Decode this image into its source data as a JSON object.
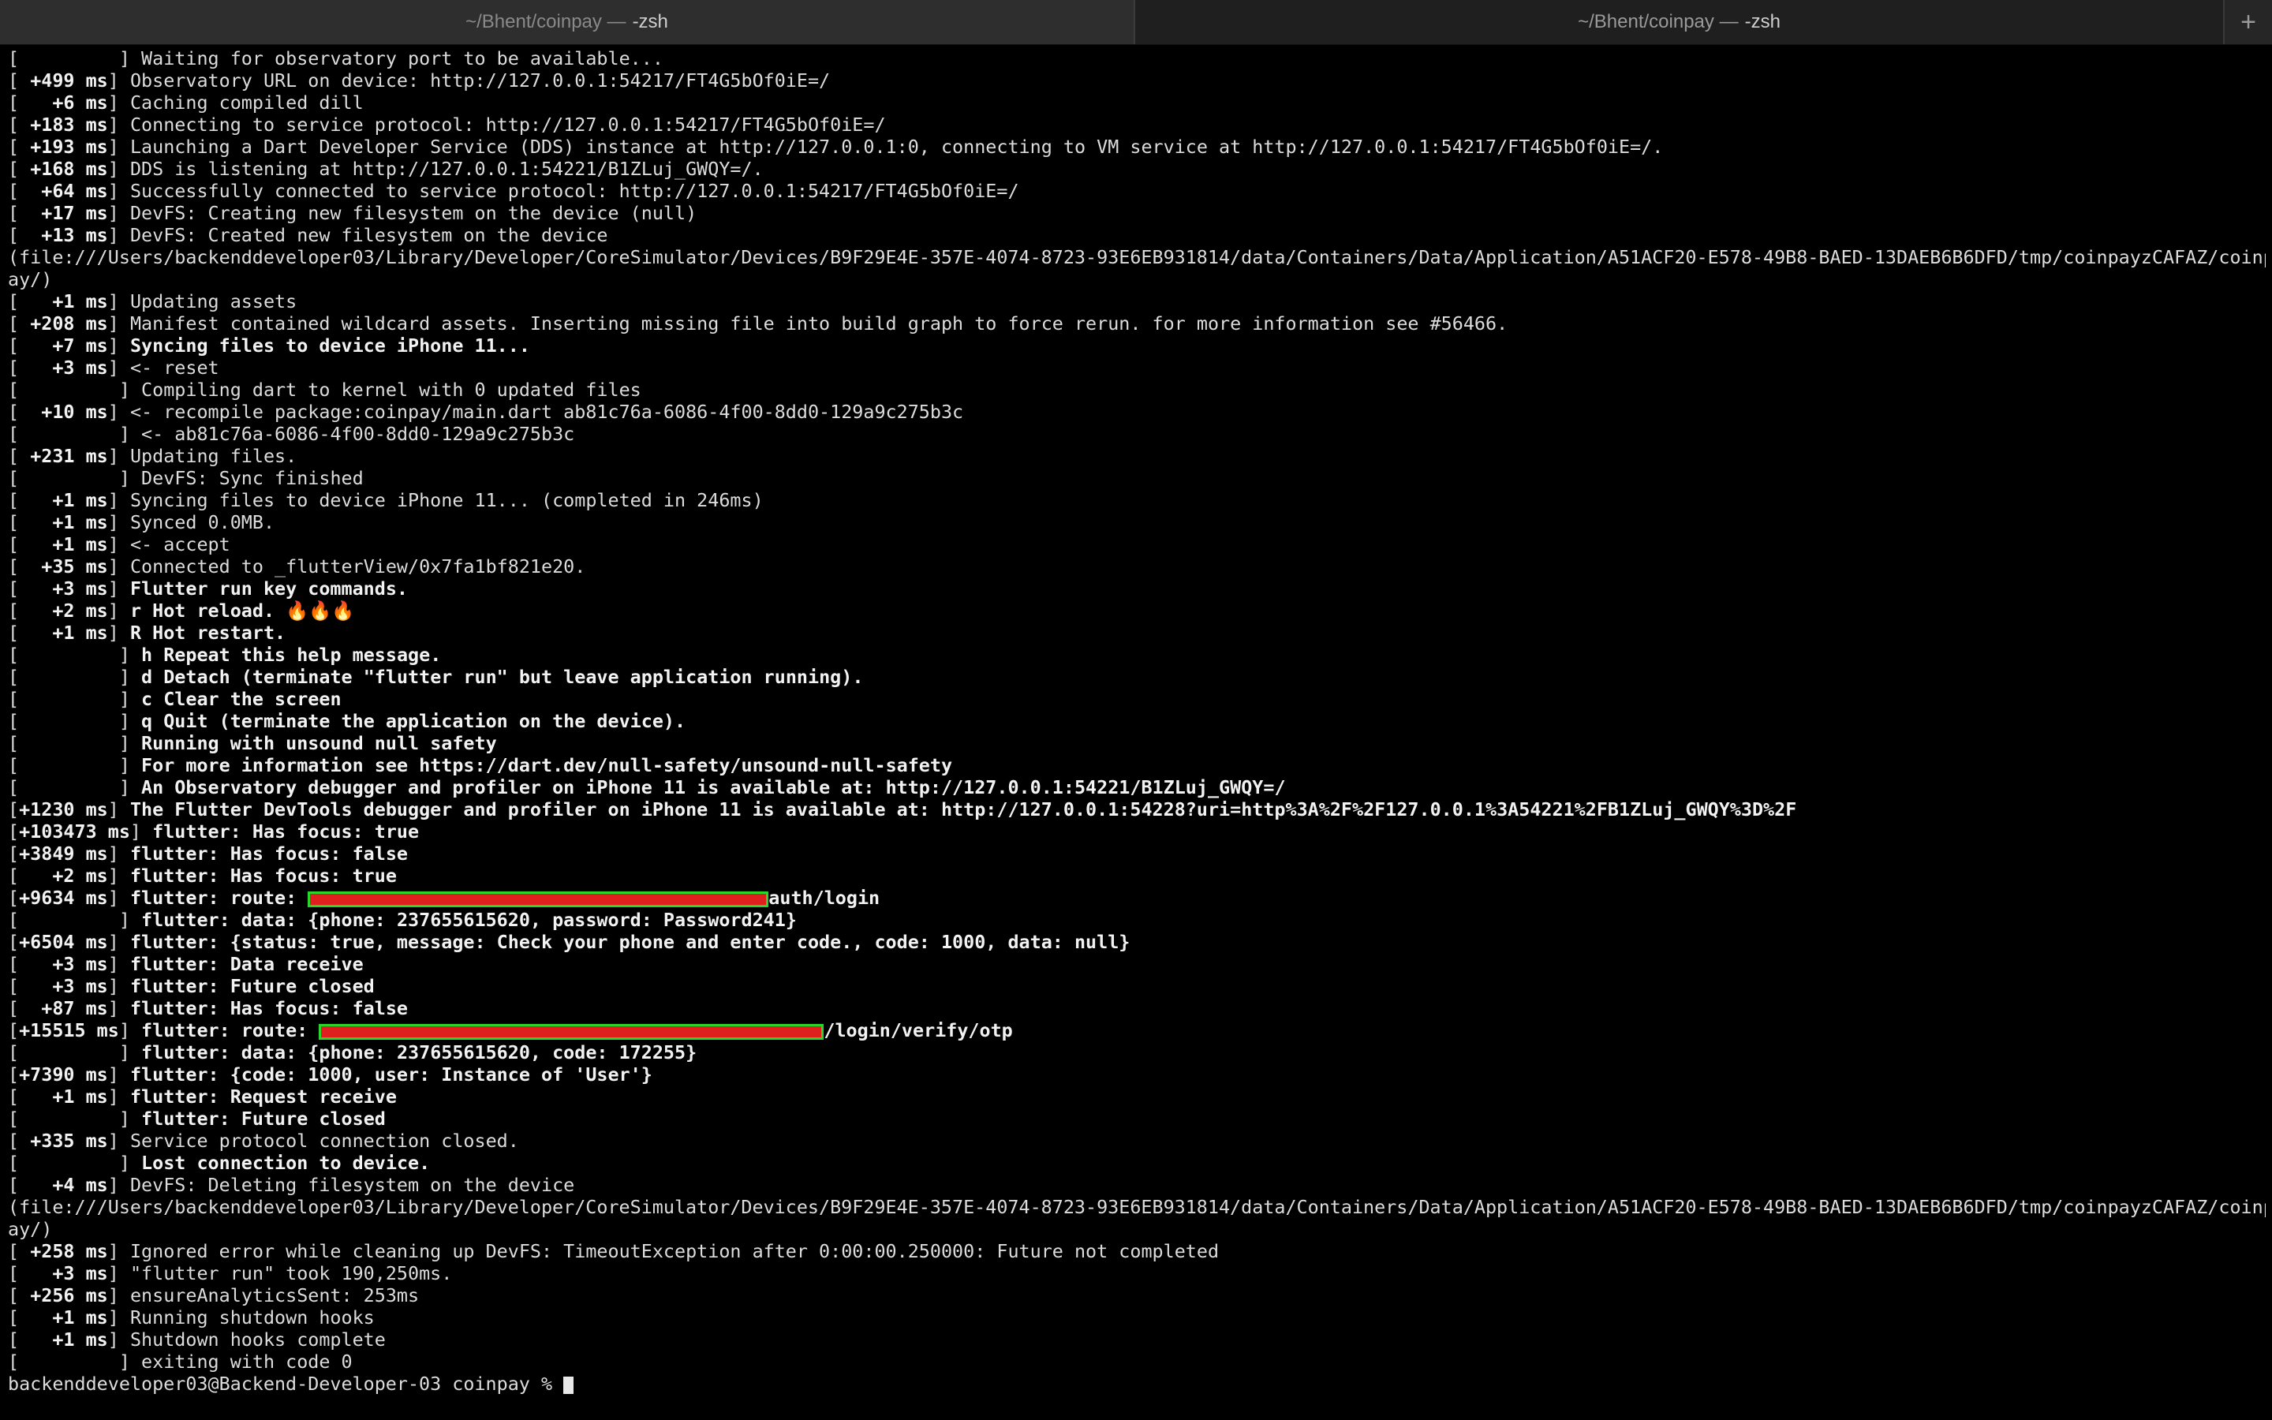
{
  "tabs": [
    {
      "path": "~/Bhent/coinpay —",
      "shell": "-zsh"
    },
    {
      "path": "~/Bhent/coinpay —",
      "shell": "-zsh"
    }
  ],
  "new_tab_label": "+",
  "lines": [
    {
      "ts": "        ",
      "text": "Waiting for observatory port to be available..."
    },
    {
      "ts": "+499 ms",
      "text": "Observatory URL on device: http://127.0.0.1:54217/FT4G5bOf0iE=/"
    },
    {
      "ts": "  +6 ms",
      "text": "Caching compiled dill"
    },
    {
      "ts": "+183 ms",
      "text": "Connecting to service protocol: http://127.0.0.1:54217/FT4G5bOf0iE=/"
    },
    {
      "ts": "+193 ms",
      "text": "Launching a Dart Developer Service (DDS) instance at http://127.0.0.1:0, connecting to VM service at http://127.0.0.1:54217/FT4G5bOf0iE=/."
    },
    {
      "ts": "+168 ms",
      "text": "DDS is listening at http://127.0.0.1:54221/B1ZLuj_GWQY=/."
    },
    {
      "ts": " +64 ms",
      "text": "Successfully connected to service protocol: http://127.0.0.1:54217/FT4G5bOf0iE=/"
    },
    {
      "ts": " +17 ms",
      "text": "DevFS: Creating new filesystem on the device (null)"
    },
    {
      "ts": " +13 ms",
      "text": "DevFS: Created new filesystem on the device"
    },
    {
      "raw": "(file:///Users/backenddeveloper03/Library/Developer/CoreSimulator/Devices/B9F29E4E-357E-4074-8723-93E6EB931814/data/Containers/Data/Application/A51ACF20-E578-49B8-BAED-13DAEB6B6DFD/tmp/coinpayzCAFAZ/coinp"
    },
    {
      "raw": "ay/)"
    },
    {
      "ts": "  +1 ms",
      "text": "Updating assets"
    },
    {
      "ts": "+208 ms",
      "text": "Manifest contained wildcard assets. Inserting missing file into build graph to force rerun. for more information see #56466."
    },
    {
      "ts": "  +7 ms",
      "text": "Syncing files to device iPhone 11...",
      "bold": true
    },
    {
      "ts": "  +3 ms",
      "text": "<- reset"
    },
    {
      "ts": "        ",
      "text": "Compiling dart to kernel with 0 updated files"
    },
    {
      "ts": " +10 ms",
      "text": "<- recompile package:coinpay/main.dart ab81c76a-6086-4f00-8dd0-129a9c275b3c"
    },
    {
      "ts": "        ",
      "text": "<- ab81c76a-6086-4f00-8dd0-129a9c275b3c"
    },
    {
      "ts": "+231 ms",
      "text": "Updating files."
    },
    {
      "ts": "        ",
      "text": "DevFS: Sync finished"
    },
    {
      "ts": "  +1 ms",
      "text": "Syncing files to device iPhone 11... (completed in 246ms)"
    },
    {
      "ts": "  +1 ms",
      "text": "Synced 0.0MB."
    },
    {
      "ts": "  +1 ms",
      "text": "<- accept"
    },
    {
      "ts": " +35 ms",
      "text": "Connected to _flutterView/0x7fa1bf821e20."
    },
    {
      "ts": "  +3 ms",
      "text": "Flutter run key commands.",
      "bold": true
    },
    {
      "ts": "  +2 ms",
      "text": "r Hot reload. ",
      "bold": true,
      "suffix": "🔥🔥🔥"
    },
    {
      "ts": "  +1 ms",
      "text": "R Hot restart.",
      "bold": true
    },
    {
      "ts": "        ",
      "text": "h Repeat this help message.",
      "bold": true
    },
    {
      "ts": "        ",
      "text": "d Detach (terminate \"flutter run\" but leave application running).",
      "bold": true
    },
    {
      "ts": "        ",
      "text": "c Clear the screen",
      "bold": true
    },
    {
      "ts": "        ",
      "text": "q Quit (terminate the application on the device).",
      "bold": true
    },
    {
      "ts": "        ",
      "text": "Running with unsound null safety",
      "bold": true
    },
    {
      "ts": "        ",
      "text": "For more information see https://dart.dev/null-safety/unsound-null-safety",
      "bold": true
    },
    {
      "ts": "        ",
      "text": "An Observatory debugger and profiler on iPhone 11 is available at: http://127.0.0.1:54221/B1ZLuj_GWQY=/",
      "bold": true
    },
    {
      "ts": "+1230 ms",
      "text": "The Flutter DevTools debugger and profiler on iPhone 11 is available at: http://127.0.0.1:54228?uri=http%3A%2F%2F127.0.0.1%3A54221%2FB1ZLuj_GWQY%3D%2F",
      "bold": true,
      "tight": true
    },
    {
      "ts": "+103473 ms",
      "text": "flutter: Has focus: true",
      "bold": true,
      "tight": true
    },
    {
      "ts": "+3849 ms",
      "text": "flutter: Has focus: false",
      "bold": true,
      "tight": true
    },
    {
      "ts": "  +2 ms",
      "text": "flutter: Has focus: true",
      "bold": true
    },
    {
      "ts": "+9634 ms",
      "text": "flutter: route: ",
      "bold": true,
      "tight": true,
      "redact_w": 584,
      "after": "auth/login"
    },
    {
      "ts": "        ",
      "text": "flutter: data: {phone: 237655615620, password: Password241}",
      "bold": true
    },
    {
      "ts": "+6504 ms",
      "text": "flutter: {status: true, message: Check your phone and enter code., code: 1000, data: null}",
      "bold": true,
      "tight": true
    },
    {
      "ts": "  +3 ms",
      "text": "flutter: Data receive",
      "bold": true
    },
    {
      "ts": "  +3 ms",
      "text": "flutter: Future closed",
      "bold": true
    },
    {
      "ts": " +87 ms",
      "text": "flutter: Has focus: false",
      "bold": true
    },
    {
      "ts": "+15515 ms",
      "text": "flutter: route: ",
      "bold": true,
      "tight": true,
      "redact_w": 640,
      "after": "/login/verify/otp"
    },
    {
      "ts": "        ",
      "text": "flutter: data: {phone: 237655615620, code: 172255}",
      "bold": true
    },
    {
      "ts": "+7390 ms",
      "text": "flutter: {code: 1000, user: Instance of 'User'}",
      "bold": true,
      "tight": true
    },
    {
      "ts": "  +1 ms",
      "text": "flutter: Request receive",
      "bold": true
    },
    {
      "ts": "        ",
      "text": "flutter: Future closed",
      "bold": true
    },
    {
      "ts": "+335 ms",
      "text": "Service protocol connection closed."
    },
    {
      "ts": "        ",
      "text": "Lost connection to device.",
      "bold": true
    },
    {
      "ts": "  +4 ms",
      "text": "DevFS: Deleting filesystem on the device"
    },
    {
      "raw": "(file:///Users/backenddeveloper03/Library/Developer/CoreSimulator/Devices/B9F29E4E-357E-4074-8723-93E6EB931814/data/Containers/Data/Application/A51ACF20-E578-49B8-BAED-13DAEB6B6DFD/tmp/coinpayzCAFAZ/coinp"
    },
    {
      "raw": "ay/)"
    },
    {
      "ts": "+258 ms",
      "text": "Ignored error while cleaning up DevFS: TimeoutException after 0:00:00.250000: Future not completed"
    },
    {
      "ts": "  +3 ms",
      "text": "\"flutter run\" took 190,250ms."
    },
    {
      "ts": "+256 ms",
      "text": "ensureAnalyticsSent: 253ms"
    },
    {
      "ts": "  +1 ms",
      "text": "Running shutdown hooks"
    },
    {
      "ts": "  +1 ms",
      "text": "Shutdown hooks complete"
    },
    {
      "ts": "        ",
      "text": "exiting with code 0"
    }
  ],
  "prompt": "backenddeveloper03@Backend-Developer-03 coinpay % "
}
